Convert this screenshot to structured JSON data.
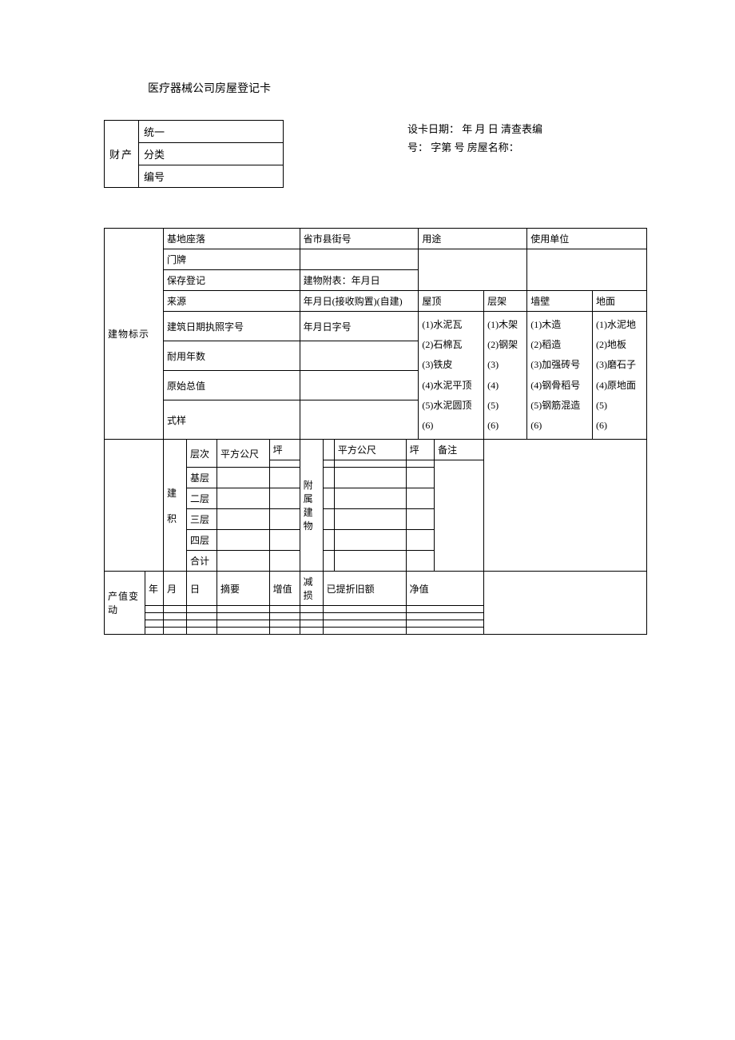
{
  "title": "医疗器械公司房屋登记卡",
  "header_right_line1": "设卡日期：  年  月  日  清查表编",
  "header_right_line2": "号：  字第  号  房屋名称：",
  "prop_table": {
    "side": "财产",
    "row1": "统一",
    "row2": "分类",
    "row3": "编号"
  },
  "main": {
    "building_label": "建物标示",
    "base_location": "基地座落",
    "base_location_val": "省市县街号",
    "usage": "用途",
    "unit": "使用单位",
    "door": "门牌",
    "preserve": "保存登记",
    "preserve_val": "建物附表：年月日",
    "source": "来源",
    "source_val": "年月日(接收购置)(自建)",
    "roof": "屋顶",
    "frame": "层架",
    "wall": "墙壁",
    "floor_surface": "地面",
    "roof_items": "(1)水泥瓦\n(2)石棉瓦\n(3)铁皮\n(4)水泥平顶\n(5)水泥圆顶\n(6)",
    "frame_items": "(1)木架\n(2)钢架\n(3)\n(4)\n(5)\n(6)",
    "wall_items": "(1)木造\n(2)稻造\n(3)加强砖号\n(4)钢骨稻号\n(5)钢筋混造\n(6)",
    "floor_items": "(1)水泥地\n(2)地板\n(3)磨石子\n(4)原地面\n(5)\n(6)",
    "build_date": "建筑日期执照字号",
    "build_date_val": "年月日字号",
    "useful_years": "耐用年数",
    "orig_value": "原始总值",
    "style": "式样",
    "build_area_label": "建\n\n积",
    "level": "层次",
    "sqm": "平方公尺",
    "ping": "坪",
    "sqm2": "平方公尺",
    "ping2": "坪",
    "remark": "备注",
    "base_floor": "基层",
    "second_floor": "二层",
    "third_floor": "三层",
    "fourth_floor": "四层",
    "total": "合计",
    "attached": "附属建物",
    "value_change": "产值变动",
    "year": "年",
    "month": "月",
    "day": "日",
    "summary": "摘要",
    "increase": "增值",
    "decrease": "减损",
    "depreciation": "已提折旧额",
    "net_value": "净值"
  }
}
